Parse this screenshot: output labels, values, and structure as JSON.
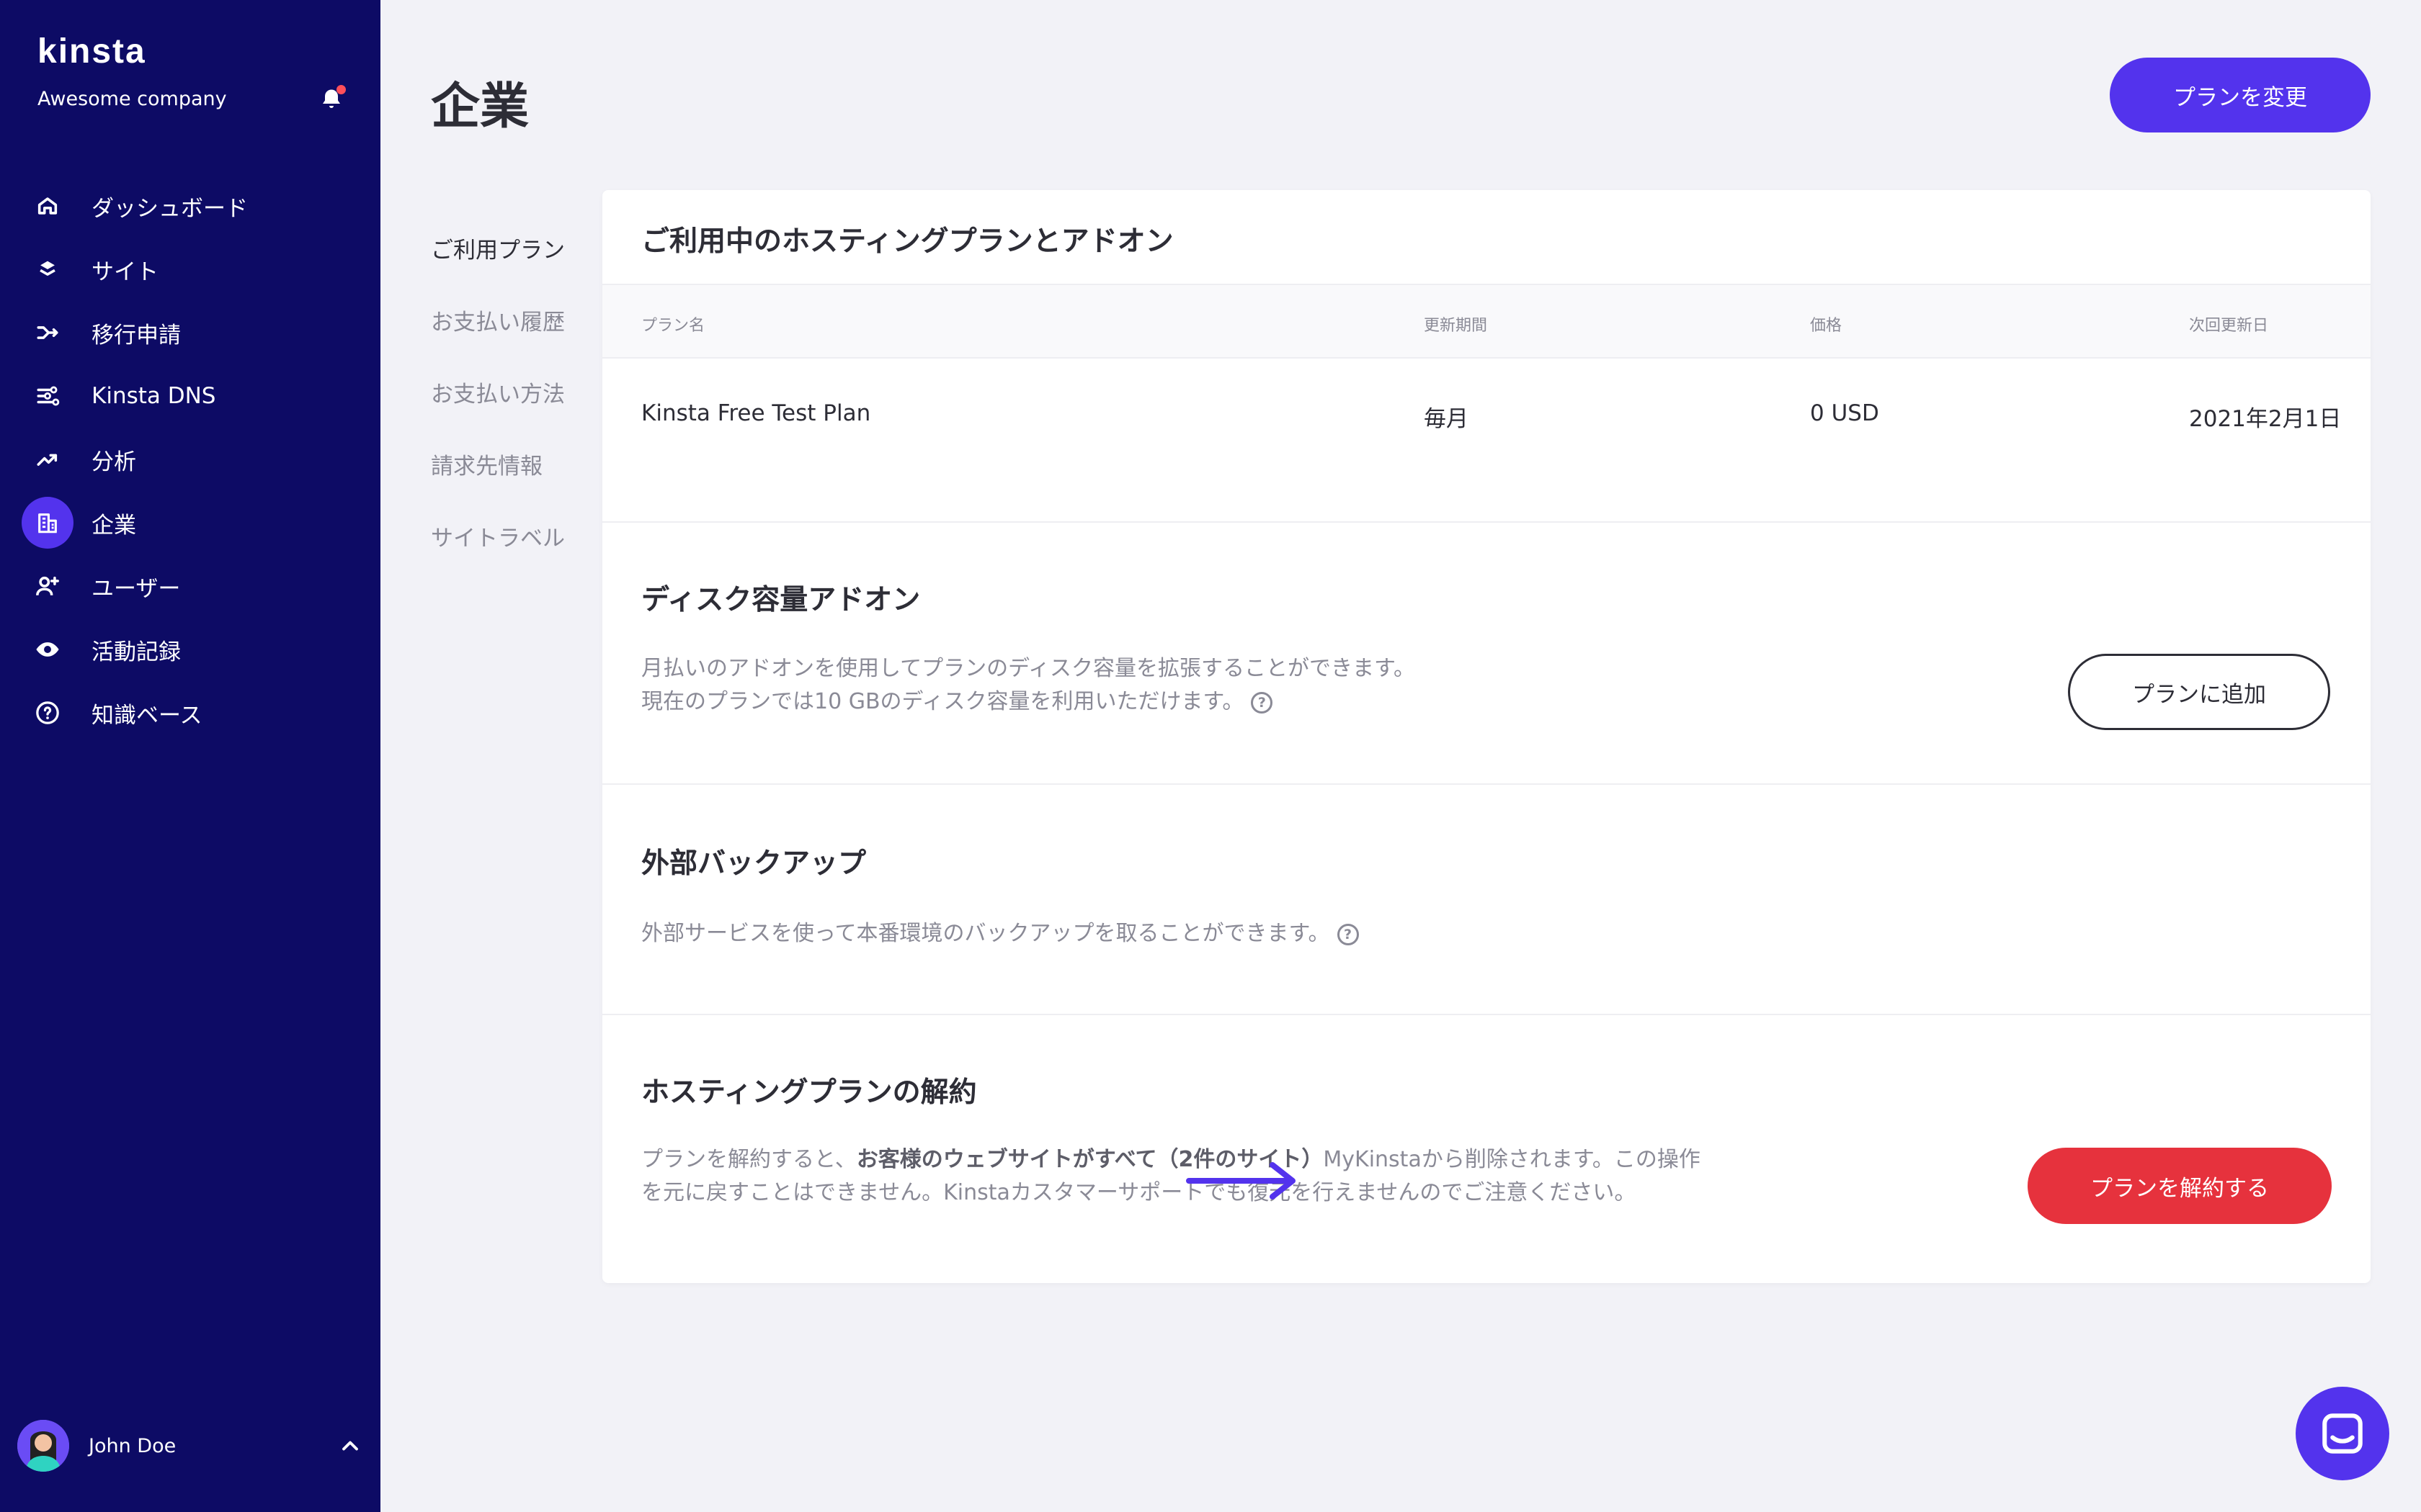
{
  "sidebar": {
    "logo": "kinsta",
    "company": "Awesome company",
    "items": [
      {
        "label": "ダッシュボード",
        "icon": "home-icon"
      },
      {
        "label": "サイト",
        "icon": "layers-icon"
      },
      {
        "label": "移行申請",
        "icon": "migration-icon"
      },
      {
        "label": "Kinsta DNS",
        "icon": "dns-icon"
      },
      {
        "label": "分析",
        "icon": "analytics-icon"
      },
      {
        "label": "企業",
        "icon": "company-icon",
        "active": true
      },
      {
        "label": "ユーザー",
        "icon": "add-user-icon"
      },
      {
        "label": "活動記録",
        "icon": "eye-icon"
      },
      {
        "label": "知識ベース",
        "icon": "help-circle-icon"
      }
    ],
    "user": {
      "name": "John Doe"
    }
  },
  "main": {
    "title": "企業",
    "change_plan_button": "プランを変更",
    "subnav": [
      {
        "label": "ご利用プラン",
        "active": true
      },
      {
        "label": "お支払い履歴"
      },
      {
        "label": "お支払い方法"
      },
      {
        "label": "請求先情報"
      },
      {
        "label": "サイトラベル"
      }
    ],
    "plan_section": {
      "title": "ご利用中のホスティングプランとアドオン",
      "columns": [
        "プラン名",
        "更新期間",
        "価格",
        "次回更新日"
      ],
      "row": {
        "plan_name": "Kinsta Free Test Plan",
        "period": "毎月",
        "price": "0 USD",
        "next_renewal": "2021年2月1日"
      }
    },
    "disk_addon": {
      "title": "ディスク容量アドオン",
      "line1": "月払いのアドオンを使用してプランのディスク容量を拡張することができます。",
      "line2": "現在のプランでは10 GBのディスク容量を利用いただけます。",
      "button": "プランに追加"
    },
    "external_backup": {
      "title": "外部バックアップ",
      "desc": "外部サービスを使って本番環境のバックアップを取ることができます。"
    },
    "cancel_plan": {
      "title": "ホスティングプランの解約",
      "desc_pre": "プランを解約すると、",
      "desc_bold": "お客様のウェブサイトがすべて（2件のサイト）",
      "desc_post1": "MyKinstaから削除されます。この操作",
      "desc_line2": "を元に戻すことはできません。Kinstaカスタマーサポートでも復元を行えませんのでご注意ください。",
      "button": "プランを解約する"
    }
  },
  "colors": {
    "sidebar_bg": "#0d0b65",
    "accent": "#5333ed",
    "danger": "#e6323d",
    "page_bg": "#f2f2f7"
  }
}
